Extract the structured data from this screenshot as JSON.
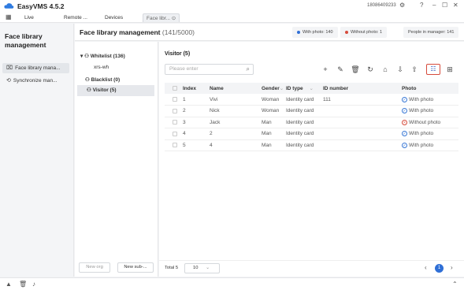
{
  "app": {
    "title": "EasyVMS 4.5.2",
    "phone": "18086409233",
    "icons": {
      "settings": "⚙",
      "help": "?",
      "minimize": "–",
      "restore": "☐",
      "close": "✕"
    }
  },
  "tabs": [
    {
      "label": "Live"
    },
    {
      "label": "Remote ..."
    },
    {
      "label": "Devices"
    },
    {
      "label": "Face libr..."
    }
  ],
  "active_tab_close": "⊙",
  "leftnav": {
    "title": "Face library management",
    "items": [
      {
        "icon": "⌧",
        "label": "Face library mana..."
      },
      {
        "icon": "⟲",
        "label": "Synchronize man..."
      }
    ]
  },
  "header": {
    "title": "Face library management",
    "count": "(141/5000)",
    "with_photo": "With photo: 140",
    "without_photo": "Without photo: 1",
    "people": "People in manager: 141",
    "colors": {
      "with": "#2f6fd6",
      "without": "#d64b3c"
    }
  },
  "tree": {
    "whitelist": "Whitelist (136)",
    "whitelist_child": "xrs-wh",
    "blacklist": "Blacklist (0)",
    "visitor": "Visitor (5)",
    "new_org": "New org",
    "new_sub": "New sub-..."
  },
  "main": {
    "subtitle": "Visitor (5)",
    "search_placeholder": "Please enter",
    "columns": [
      "Index",
      "Name",
      "Gender",
      "ID type",
      "ID number",
      "Photo"
    ],
    "rows": [
      {
        "index": "1",
        "name": "Vivi",
        "gender": "Woman",
        "id_type": "Identity card",
        "id_number": "111",
        "photo": "With photo",
        "has_photo": true
      },
      {
        "index": "2",
        "name": "Nick",
        "gender": "Woman",
        "id_type": "Identity card",
        "id_number": "",
        "photo": "With photo",
        "has_photo": true
      },
      {
        "index": "3",
        "name": "Jack",
        "gender": "Man",
        "id_type": "Identity card",
        "id_number": "",
        "photo": "Without photo",
        "has_photo": false
      },
      {
        "index": "4",
        "name": "2",
        "gender": "Man",
        "id_type": "Identity card",
        "id_number": "",
        "photo": "With photo",
        "has_photo": true
      },
      {
        "index": "5",
        "name": "4",
        "gender": "Man",
        "id_type": "Identity card",
        "id_number": "",
        "photo": "With photo",
        "has_photo": true
      }
    ]
  },
  "footer": {
    "total": "Total 5",
    "page_size": "10",
    "page": "1"
  }
}
